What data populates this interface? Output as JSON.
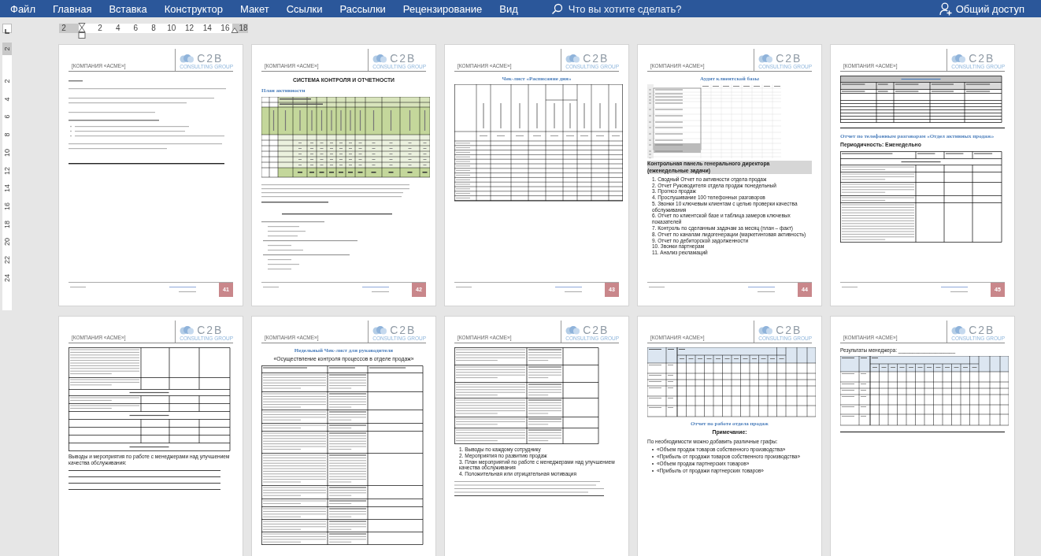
{
  "menu": {
    "tabs": [
      "Файл",
      "Главная",
      "Вставка",
      "Конструктор",
      "Макет",
      "Ссылки",
      "Рассылки",
      "Рецензирование",
      "Вид"
    ],
    "search": "Что вы хотите сделать?",
    "share": "Общий доступ"
  },
  "ruler": {
    "horizontal": [
      "2",
      "2",
      "4",
      "6",
      "8",
      "10",
      "12",
      "14",
      "16",
      "18"
    ],
    "vertical": [
      "2",
      "2",
      "4",
      "6",
      "8",
      "10",
      "12",
      "14",
      "16",
      "18",
      "20",
      "22",
      "24"
    ]
  },
  "pages": [
    {
      "company": "[КОМПАНИЯ «АСМЕ»]",
      "logo_mark": "C2B",
      "logo_tagline": "CONSULTING GROUP",
      "page_number": "41",
      "blocks": [
        {
          "kind": "notes"
        }
      ]
    },
    {
      "company": "[КОМПАНИЯ «АСМЕ»]",
      "logo_mark": "C2B",
      "logo_tagline": "CONSULTING GROUP",
      "page_number": "42",
      "blocks": [
        {
          "kind": "title",
          "centered": true,
          "text": "СИСТЕМА КОНТРОЛЯ И ОТЧЕТНОСТИ"
        },
        {
          "kind": "caption",
          "centered": false,
          "text": "План активности"
        },
        {
          "kind": "activity-table"
        },
        {
          "kind": "paragraph-lines"
        }
      ]
    },
    {
      "company": "[КОМПАНИЯ «АСМЕ»]",
      "logo_mark": "C2B",
      "logo_tagline": "CONSULTING GROUP",
      "page_number": "43",
      "blocks": [
        {
          "kind": "caption",
          "centered": true,
          "text": "Чек-лист «Расписание дня»"
        },
        {
          "kind": "schedule-table"
        }
      ]
    },
    {
      "company": "[КОМПАНИЯ «АСМЕ»]",
      "logo_mark": "C2B",
      "logo_tagline": "CONSULTING GROUP",
      "page_number": "44",
      "blocks": [
        {
          "kind": "caption",
          "centered": true,
          "text": "Аудит клиентской базы"
        },
        {
          "kind": "spreadsheet"
        },
        {
          "kind": "highlight-heading",
          "centered": false,
          "text": "Контрольная панель генерального директора (еженедельные задачи)"
        },
        {
          "kind": "numbered",
          "items": [
            "1. Сводный Отчет по активности отдела продаж",
            "2. Отчет Руководителя отдела продаж понедельный",
            "3. Прогноз продаж",
            "4. Прослушивание 100 телефонных разговоров",
            "5. Звонки 10 ключевым клиентам с целью проверки качества обслуживания",
            "6. Отчет по клиентской базе и таблица замеров ключевых показателей",
            "7. Контроль по сделанным задачам за месяц (план – факт)",
            "8. Отчет по каналам лидогенерации (маркетинговая активность)",
            "9. Отчет по дебиторской задолженности",
            "10. Звонки партнерам",
            "11. Анализ рекламаций"
          ]
        }
      ]
    },
    {
      "company": "[КОМПАНИЯ «АСМЕ»]",
      "logo_mark": "C2B",
      "logo_tagline": "CONSULTING GROUP",
      "page_number": "45",
      "blocks": [
        {
          "kind": "upsell-table"
        },
        {
          "kind": "rule"
        },
        {
          "kind": "caption",
          "centered": false,
          "text": "Отчет по телефонным разговорам «Отдел активных продаж»"
        },
        {
          "kind": "bold-heading",
          "centered": false,
          "text": "Периодичность: Еженедельно"
        },
        {
          "kind": "phone-table"
        }
      ]
    },
    {
      "company": "[КОМПАНИЯ «АСМЕ»]",
      "logo_mark": "C2B",
      "logo_tagline": "CONSULTING GROUP",
      "blocks": [
        {
          "kind": "cross-sell-table"
        },
        {
          "kind": "paragraph",
          "text": "Выводы и мероприятия по работе с менеджерами над улучшением качества обслуживания:"
        },
        {
          "kind": "fill-lines"
        }
      ]
    },
    {
      "company": "[КОМПАНИЯ «АСМЕ»]",
      "logo_mark": "C2B",
      "logo_tagline": "CONSULTING GROUP",
      "blocks": [
        {
          "kind": "caption",
          "centered": true,
          "text": "Недельный Чек-лист для руководителя"
        },
        {
          "kind": "plain-heading",
          "centered": true,
          "text": "«Осуществление контроля процессов в отделе продаж»"
        },
        {
          "kind": "checklist-table"
        }
      ]
    },
    {
      "company": "[КОМПАНИЯ «АСМЕ»]",
      "logo_mark": "C2B",
      "logo_tagline": "CONSULTING GROUP",
      "blocks": [
        {
          "kind": "checklist-continued-table"
        },
        {
          "kind": "numbered",
          "items": [
            "1. Выводы по каждому сотруднику",
            "2. Мероприятия по развитию продаж",
            "3. План мероприятий по работе с менеджерами над улучшением качества обслуживания",
            "4. Положительная или отрицательная мотивация"
          ]
        },
        {
          "kind": "fine-print"
        }
      ]
    },
    {
      "company": "[КОМПАНИЯ «АСМЕ»]",
      "logo_mark": "C2B",
      "logo_tagline": "CONSULTING GROUP",
      "blocks": [
        {
          "kind": "sales-table"
        },
        {
          "kind": "caption",
          "centered": true,
          "text": "Отчет по работе отдела продаж"
        },
        {
          "kind": "bold-heading",
          "centered": true,
          "text": "Примечание:"
        },
        {
          "kind": "paragraph",
          "text": "По необходимости можно добавить различные графы:"
        },
        {
          "kind": "bullets",
          "items": [
            "«Объем продаж товаров собственного производства»",
            "«Прибыль от продажи товаров собственного производства»",
            "«Объем продаж партнерских товаров»",
            "«Прибыль от продажи партнерских товаров»"
          ]
        }
      ]
    },
    {
      "company": "[КОМПАНИЯ «АСМЕ»]",
      "logo_mark": "C2B",
      "logo_tagline": "CONSULTING GROUP",
      "blocks": [
        {
          "kind": "paragraph",
          "text": "Результаты менеджера: ____________________"
        },
        {
          "kind": "sales-table"
        },
        {
          "kind": "rule"
        }
      ]
    }
  ]
}
